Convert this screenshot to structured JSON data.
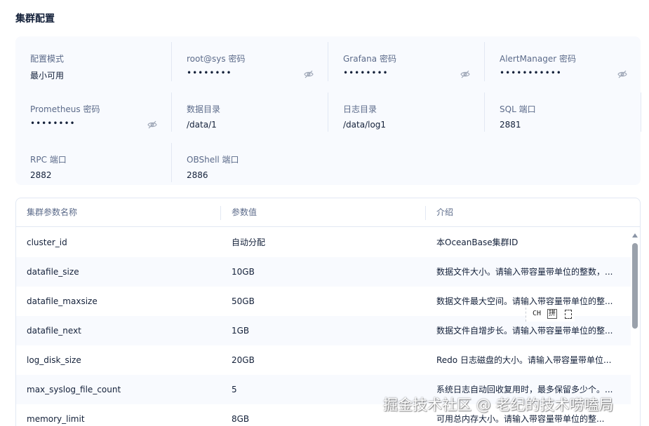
{
  "page": {
    "title": "集群配置"
  },
  "config": {
    "items": [
      {
        "label": "配置模式",
        "value": "最小可用",
        "masked": false
      },
      {
        "label": "root@sys 密码",
        "value": "••••••••",
        "masked": true
      },
      {
        "label": "Grafana 密码",
        "value": "••••••••",
        "masked": true
      },
      {
        "label": "AlertManager 密码",
        "value": "•••••••••••",
        "masked": true
      },
      {
        "label": "Prometheus 密码",
        "value": "••••••••",
        "masked": true
      },
      {
        "label": "数据目录",
        "value": "/data/1",
        "masked": false
      },
      {
        "label": "日志目录",
        "value": "/data/log1",
        "masked": false
      },
      {
        "label": "SQL 端口",
        "value": "2881",
        "masked": false
      },
      {
        "label": "RPC 端口",
        "value": "2882",
        "masked": false
      },
      {
        "label": "OBShell 端口",
        "value": "2886",
        "masked": false
      }
    ]
  },
  "params_table": {
    "columns": [
      "集群参数名称",
      "参数值",
      "介绍"
    ],
    "rows": [
      {
        "name": "cluster_id",
        "value": "自动分配",
        "desc": "本OceanBase集群ID"
      },
      {
        "name": "datafile_size",
        "value": "10GB",
        "desc": "数据文件大小。请输入带容量带单位的整数，..."
      },
      {
        "name": "datafile_maxsize",
        "value": "50GB",
        "desc": "数据文件最大空间。请输入带容量带单位的整..."
      },
      {
        "name": "datafile_next",
        "value": "1GB",
        "desc": "数据文件自增步长。请输入带容量带单位的整..."
      },
      {
        "name": "log_disk_size",
        "value": "20GB",
        "desc": "Redo 日志磁盘的大小。请输入带容量带单位..."
      },
      {
        "name": "max_syslog_file_count",
        "value": "5",
        "desc": "系统日志自动回收复用时，最多保留多少个。..."
      },
      {
        "name": "memory_limit",
        "value": "8GB",
        "desc": "可用总内存大小。请输入带容量带单位的整..."
      }
    ]
  },
  "ime": {
    "mode": "CH",
    "pinyin": "拼"
  },
  "watermark": {
    "text": "掘金技术社区 @ 老纪的技术唠嗑局"
  },
  "icons": {
    "password_toggle": "eye-off-icon"
  },
  "colors": {
    "label": "#5c6b8a",
    "text": "#132039",
    "panel_bg": "#f8fafe",
    "border": "#e2e8f3"
  }
}
